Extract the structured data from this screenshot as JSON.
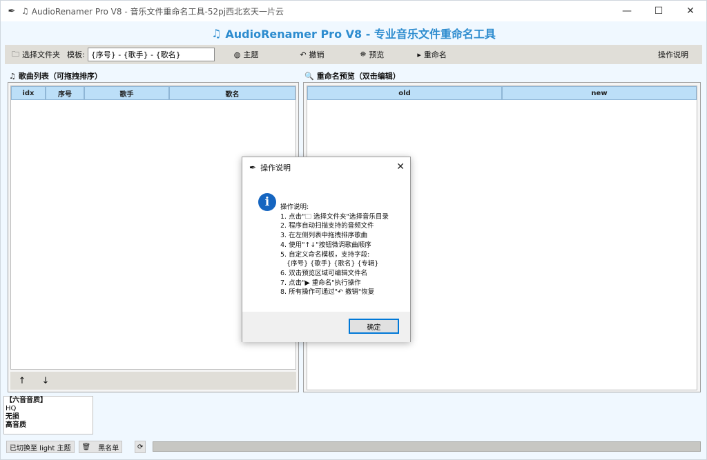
{
  "titlebar": {
    "title": "AudioRenamer Pro V8 - 音乐文件重命名工具-52pj西北玄天一片云",
    "minimize": "—",
    "maximize": "☐",
    "close": "✕"
  },
  "header": {
    "title": "AudioRenamer Pro V8 - 专业音乐文件重命名工具"
  },
  "toolbar": {
    "select_folder": "选择文件夹",
    "template_label": "模板:",
    "template_value": "{序号} - {歌手} - {歌名}",
    "theme": "主题",
    "undo": "撤销",
    "preview": "预览",
    "rename": "重命名",
    "help": "操作说明"
  },
  "left_panel": {
    "title": "歌曲列表（可拖拽排序）",
    "columns": [
      "idx",
      "序号",
      "歌手",
      "歌名"
    ],
    "up": "↑",
    "down": "↓"
  },
  "right_panel": {
    "title": "重命名预览（双击编辑）",
    "columns": [
      "old",
      "new"
    ]
  },
  "quality": {
    "items": [
      "【六音音质】",
      "HQ",
      "无损",
      "高音质"
    ]
  },
  "status": {
    "theme_status": "已切换至 light 主题",
    "blacklist": "黑名单",
    "progress": 0
  },
  "dialog": {
    "title": "操作说明",
    "close": "✕",
    "text": "操作说明:\n1. 点击\"🗀 选择文件夹\"选择音乐目录\n2. 程序自动扫描支持的音频文件\n3. 在左侧列表中拖拽排序歌曲\n4. 使用\"↑↓\"按钮微调歌曲顺序\n5. 自定义命名模板，支持字段:\n   {序号} {歌手} {歌名} {专辑}\n6. 双击预览区域可编辑文件名\n7. 点击\"▶ 重命名\"执行操作\n8. 所有操作可通过\"↶ 撤销\"恢复",
    "ok": "确定"
  },
  "colors": {
    "accent": "#2d8ccf",
    "table_header": "#bcdff8",
    "toolbar": "#e0ded8",
    "info": "#1565c0"
  }
}
